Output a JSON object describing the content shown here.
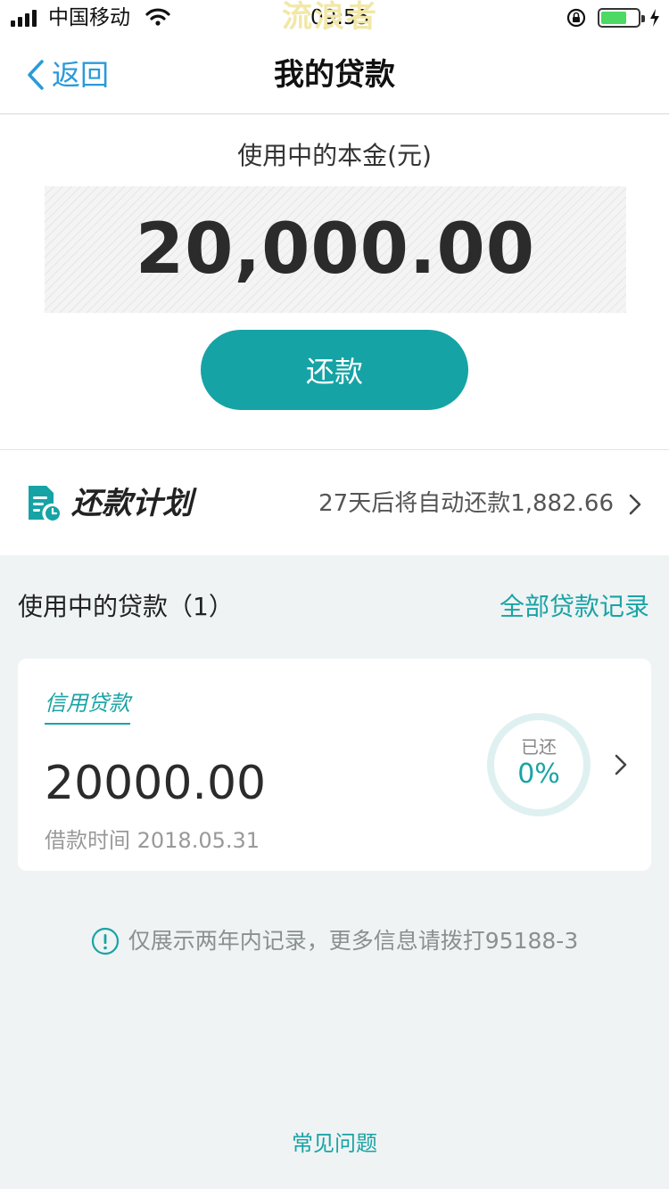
{
  "status_bar": {
    "carrier": "中国移动",
    "time": "09:55",
    "watermark": "流浪者"
  },
  "nav": {
    "back_label": "返回",
    "title": "我的贷款"
  },
  "summary": {
    "principal_label": "使用中的本金(元)",
    "amount": "20,000.00",
    "repay_button": "还款"
  },
  "plan": {
    "title": "还款计划",
    "info": "27天后将自动还款1,882.66"
  },
  "loans": {
    "section_title": "使用中的贷款（1）",
    "all_records_label": "全部贷款记录",
    "items": [
      {
        "type": "信用贷款",
        "amount": "20000.00",
        "date_label": "借款时间 2018.05.31",
        "repaid_label": "已还",
        "repaid_percent": "0%",
        "repaid_fraction": 0
      }
    ]
  },
  "notice": "仅展示两年内记录，更多信息请拨打95188-3",
  "faq_label": "常见问题",
  "colors": {
    "accent": "#1aa3a5",
    "button": "#16a3a5",
    "link_blue": "#2a9ad9",
    "background": "#eff3f4"
  }
}
